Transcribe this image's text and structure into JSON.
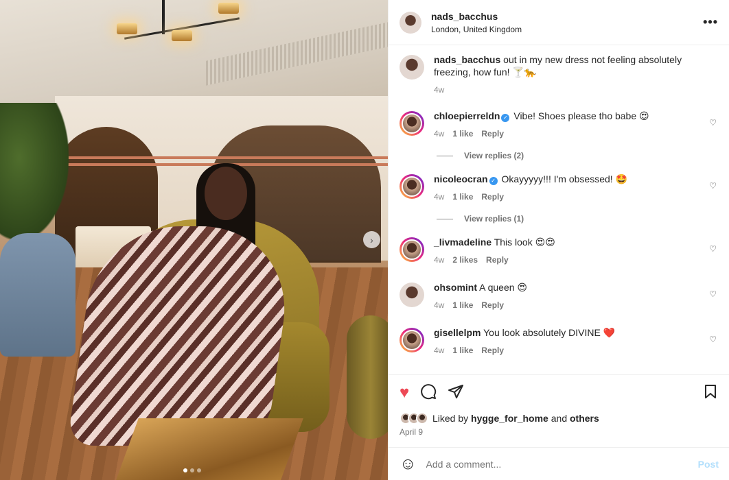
{
  "post": {
    "username": "nads_bacchus",
    "location": "London, United Kingdom",
    "caption": {
      "username": "nads_bacchus",
      "text": "out in my new dress not feeling absolutely freezing, how fun! 🍸🐆",
      "time": "4w"
    },
    "more_icon": "more-icon",
    "photo_dots": 3,
    "active_dot": 1
  },
  "comments": [
    {
      "username": "chloepierreldn",
      "verified": true,
      "text": "Vibe! Shoes please tho babe 😍",
      "time": "4w",
      "likes": "1 like",
      "reply": "Reply",
      "view_replies": "View replies (2)"
    },
    {
      "username": "nicoleocran",
      "verified": true,
      "text": "Okayyyyy!!! I'm obsessed! 🤩",
      "time": "4w",
      "likes": "1 like",
      "reply": "Reply",
      "view_replies": "View replies (1)"
    },
    {
      "username": "_livmadeline",
      "verified": false,
      "text": "This look 😍😍",
      "time": "4w",
      "likes": "2 likes",
      "reply": "Reply"
    },
    {
      "username": "ohsomint",
      "verified": false,
      "text": "A queen 😍",
      "time": "4w",
      "likes": "1 like",
      "reply": "Reply"
    },
    {
      "username": "gisellelpm",
      "verified": false,
      "text": "You look absolutely DIVINE ❤️",
      "time": "4w",
      "likes": "1 like",
      "reply": "Reply"
    }
  ],
  "actions": {
    "liked_by_prefix": "Liked by",
    "liked_by_user": "hygge_for_home",
    "liked_by_and": "and",
    "liked_by_others": "others",
    "date": "April 9",
    "like_color": "#ed4956"
  },
  "composer": {
    "placeholder": "Add a comment...",
    "post_label": "Post"
  }
}
